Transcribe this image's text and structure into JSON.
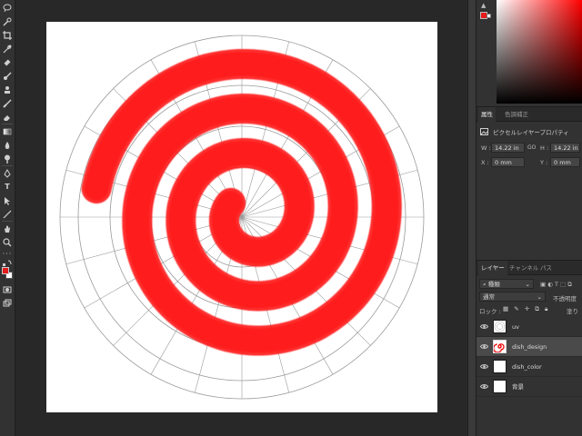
{
  "toolbar": {
    "tools": [
      "lasso-icon",
      "quick-select-icon",
      "crop-icon",
      "eyedropper-icon",
      "healing-icon",
      "brush-icon",
      "stamp-icon",
      "history-brush-icon",
      "eraser-icon",
      "gradient-icon",
      "blur-icon",
      "dodge-icon",
      "pen-icon",
      "text-icon",
      "path-select-icon",
      "line-icon",
      "hand-icon",
      "zoom-icon",
      "more-icon",
      "swap-colors-icon",
      "foreground-color",
      "quick-mask-icon",
      "screen-mode-icon"
    ],
    "text_tool_glyph": "T"
  },
  "canvas": {
    "background": "#ffffff",
    "spiral_color": "#ff1a1a",
    "guide_color": "#9a9a9a"
  },
  "color_panel": {
    "foreground": "#e51c1c",
    "background": "#ffffff",
    "hue": "#ff0000"
  },
  "properties": {
    "tabs": [
      "属性",
      "色調補正"
    ],
    "title": "ピクセルレイヤープロパティ",
    "w_label": "W :",
    "w_value": "14.22 in",
    "link_glyph": "GO",
    "h_label": "H :",
    "h_value": "14.22 in",
    "x_label": "X :",
    "x_value": "0 mm",
    "y_label": "Y :",
    "y_value": "0 mm"
  },
  "layers_panel": {
    "tabs": [
      "レイヤー",
      "チャンネル",
      "パス"
    ],
    "filter_label": "種類",
    "blend_mode": "通常",
    "opacity_label": "不透明度",
    "lock_label": "ロック :",
    "fill_label": "塗り",
    "layers": [
      {
        "name": "uv",
        "selected": false,
        "thumb": "grid"
      },
      {
        "name": "dish_design",
        "selected": true,
        "thumb": "spiral"
      },
      {
        "name": "dish_color",
        "selected": false,
        "thumb": "white"
      },
      {
        "name": "背景",
        "selected": false,
        "thumb": "white"
      }
    ]
  }
}
